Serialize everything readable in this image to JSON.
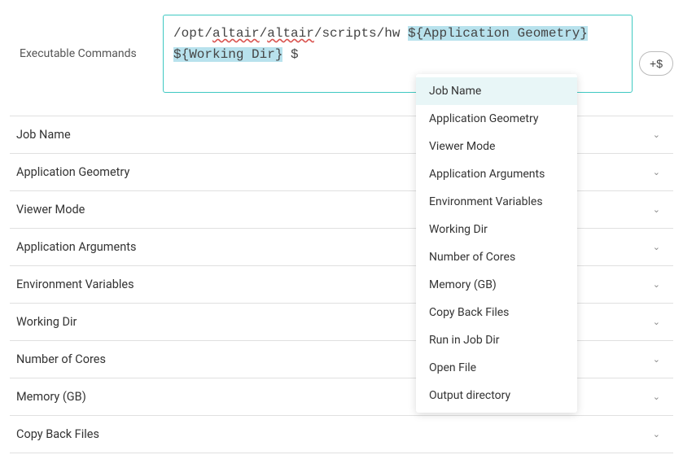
{
  "exec": {
    "label": "Executable Commands",
    "value_prefix": "/opt/",
    "value_err1": "altair",
    "value_sep1": "/",
    "value_err2": "altair",
    "value_mid": "/scripts/hw ",
    "value_hl1": "${Application Geometry}",
    "value_hl_sep": " ",
    "value_hl2": "${Working Dir}",
    "value_tail": " $",
    "add_button_label": "+$"
  },
  "dropdown": {
    "items": [
      "Job Name",
      "Application Geometry",
      "Viewer Mode",
      "Application Arguments",
      "Environment Variables",
      "Working Dir",
      "Number of Cores",
      "Memory (GB)",
      "Copy Back Files",
      "Run in Job Dir",
      "Open File",
      "Output directory"
    ]
  },
  "accordion": {
    "items": [
      "Job Name",
      "Application Geometry",
      "Viewer Mode",
      "Application Arguments",
      "Environment Variables",
      "Working Dir",
      "Number of Cores",
      "Memory (GB)",
      "Copy Back Files"
    ]
  }
}
